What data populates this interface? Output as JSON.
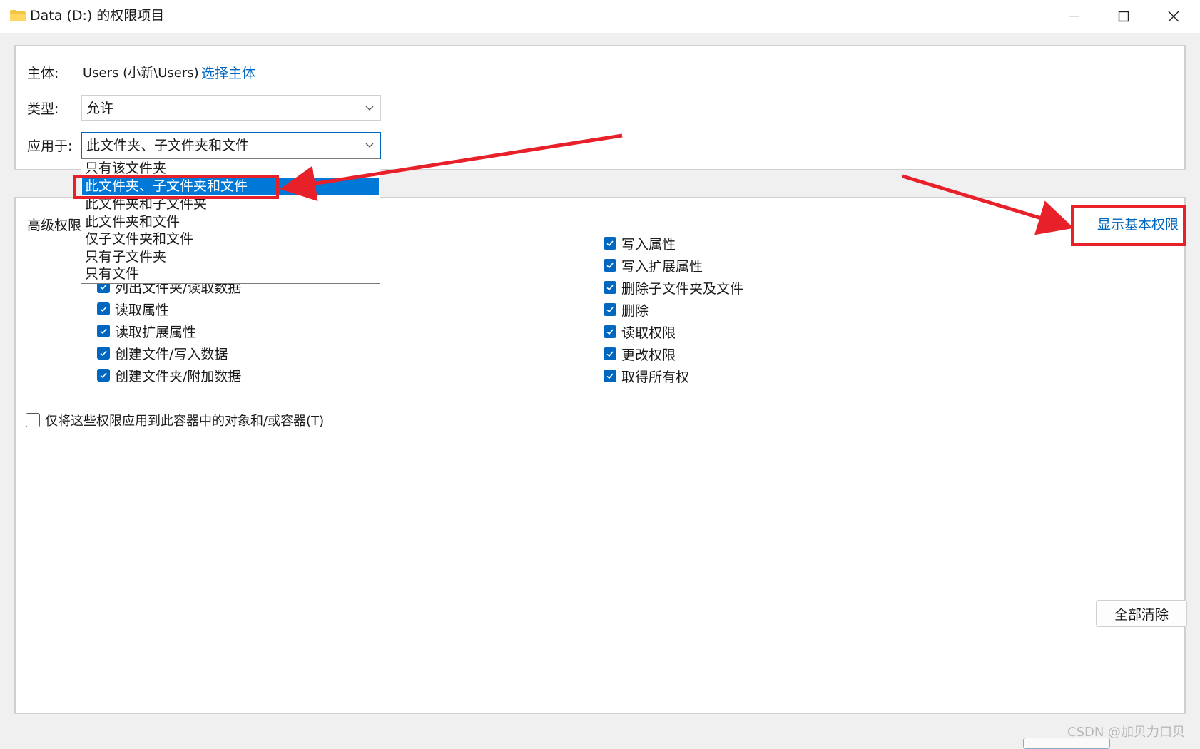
{
  "window": {
    "title": "Data (D:) 的权限项目"
  },
  "principal": {
    "label": "主体:",
    "value": "Users (小新\\Users)",
    "select_link": "选择主体"
  },
  "type": {
    "label": "类型:",
    "selected": "允许"
  },
  "apply_to": {
    "label": "应用于:",
    "selected": "此文件夹、子文件夹和文件",
    "options": [
      "只有该文件夹",
      "此文件夹、子文件夹和文件",
      "此文件夹和子文件夹",
      "此文件夹和文件",
      "仅子文件夹和文件",
      "只有子文件夹",
      "只有文件"
    ],
    "highlighted_index": 1
  },
  "advanced": {
    "label_partial": "高级权限",
    "show_basic_link": "显示基本权限",
    "left_permissions": [
      {
        "label": "列出文件夹/读取数据",
        "checked": true
      },
      {
        "label": "读取属性",
        "checked": true
      },
      {
        "label": "读取扩展属性",
        "checked": true
      },
      {
        "label": "创建文件/写入数据",
        "checked": true
      },
      {
        "label": "创建文件夹/附加数据",
        "checked": true
      }
    ],
    "right_permissions": [
      {
        "label": "写入属性",
        "checked": true
      },
      {
        "label": "写入扩展属性",
        "checked": true
      },
      {
        "label": "删除子文件夹及文件",
        "checked": true
      },
      {
        "label": "删除",
        "checked": true
      },
      {
        "label": "读取权限",
        "checked": true
      },
      {
        "label": "更改权限",
        "checked": true
      },
      {
        "label": "取得所有权",
        "checked": true
      }
    ],
    "apply_only_container": {
      "label": "仅将这些权限应用到此容器中的对象和/或容器(T)",
      "checked": false
    },
    "clear_all_button": "全部清除"
  },
  "watermark": "CSDN @加贝力口贝",
  "colors": {
    "accent": "#0067c0",
    "selection": "#0078d7",
    "annotation": "#e8202a"
  }
}
